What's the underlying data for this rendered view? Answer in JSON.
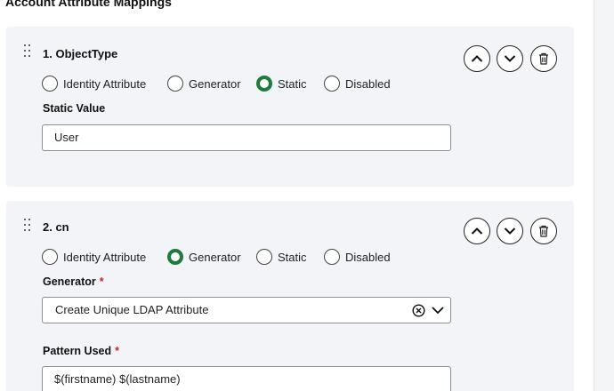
{
  "section": {
    "title": "Account Attribute Mappings"
  },
  "source_options": [
    "Identity Attribute",
    "Generator",
    "Static",
    "Disabled"
  ],
  "mappings": [
    {
      "title": "1. ObjectType",
      "selected": "Static",
      "field_label": "Static Value",
      "field_value": "User"
    },
    {
      "title": "2. cn",
      "selected": "Generator",
      "generator_label": "Generator",
      "generator_value": "Create Unique LDAP Attribute",
      "pattern_label": "Pattern Used",
      "pattern_value": "$(firstname) $(lastname)",
      "required_mark": "*"
    }
  ],
  "colors": {
    "card_bg": "#f2f4f7",
    "radio_checked": "#1f7a3d",
    "required": "#c0282f"
  },
  "icons": {
    "move_up": "chevron-up-icon",
    "move_down": "chevron-down-icon",
    "delete": "trash-icon",
    "drag": "drag-handle-icon",
    "clear": "clear-circle-icon"
  }
}
